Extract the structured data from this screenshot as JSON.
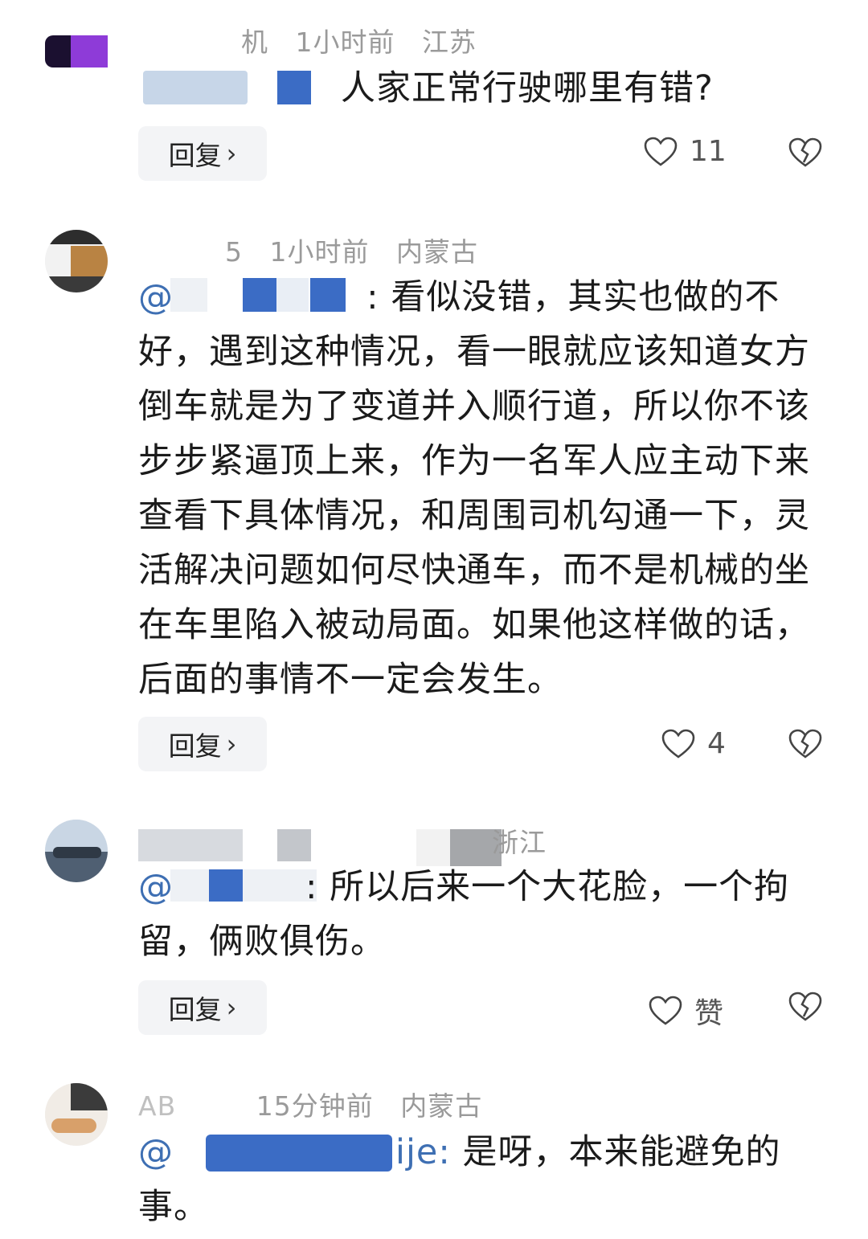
{
  "comments": [
    {
      "meta": {
        "name_fragment": "机",
        "time": "1小时前",
        "location": "江苏"
      },
      "text": "人家正常行驶哪里有错?",
      "reply_label": "回复",
      "like_count": "11"
    },
    {
      "meta": {
        "name_fragment": "5",
        "time": "1小时前",
        "location": "内蒙古"
      },
      "mention_prefix": "@",
      "mention_suffix": " :",
      "text": " 看似没错，其实也做的不好，遇到这种情况，看一眼就应该知道女方倒车就是为了变道并入顺行道，所以你不该步步紧逼顶上来，作为一名军人应主动下来查看下具体情况，和周围司机勾通一下，灵活解决问题如何尽快通车，而不是机械的坐在车里陷入被动局面。如果他这样做的话，后面的事情不一定会发生。",
      "reply_label": "回复",
      "like_count": "4"
    },
    {
      "meta": {
        "location": "浙江"
      },
      "mention_prefix": "@",
      "mention_suffix": ":",
      "text": " 所以后来一个大花脸，一个拘留，俩败俱伤。",
      "reply_label": "回复",
      "like_count": "赞"
    },
    {
      "meta": {
        "name_fragment": "AB",
        "time": "15分钟前",
        "location": "内蒙古"
      },
      "mention_prefix": "@",
      "mention_suffix": "ije:",
      "text": " 是呀，本来能避免的事。"
    }
  ],
  "icons": {
    "like": "heart-outline-icon",
    "dislike": "broken-heart-icon",
    "chevron": "chevron-right-icon"
  },
  "colors": {
    "mention": "#3e6fb3",
    "meta": "#9a9a9a",
    "mask_blue": "#3b6cc5",
    "mask_gray": "#c9cdd3"
  }
}
